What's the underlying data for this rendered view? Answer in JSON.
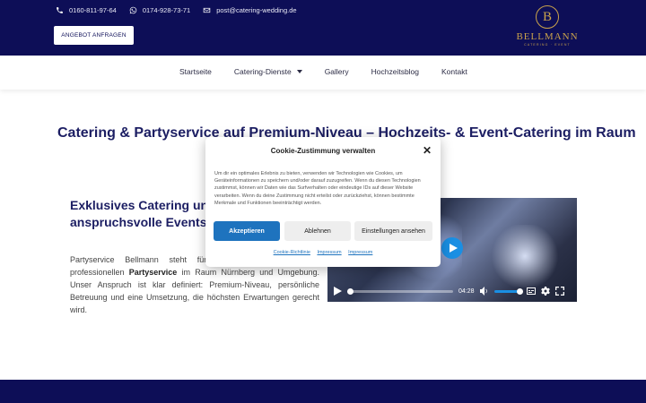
{
  "topbar": {
    "phone1": "0160-811-97-64",
    "phone2": "0174-928-73-71",
    "email": "post@catering-wedding.de",
    "cta_label": "ANGEBOT ANFRAGEN",
    "bg_color": "#0d0e57"
  },
  "logo": {
    "monogram": "B",
    "brand": "BELLMANN",
    "tagline": "CATERING · EVENT",
    "gold_color": "#c9a24b"
  },
  "nav": {
    "items": [
      {
        "label": "Startseite"
      },
      {
        "label": "Catering-Dienste"
      },
      {
        "label": "Gallery"
      },
      {
        "label": "Hochzeitsblog"
      },
      {
        "label": "Kontakt"
      }
    ]
  },
  "main": {
    "headline": "Catering & Partyservice auf Premium-Niveau – Hochzeits- & Event-Catering im Raum",
    "subhead": "Exklusives Catering und Partyservice für anspruchsvolle Events",
    "para_pre": "Partyservice Bellmann steht für exklusives Catering und professionellen ",
    "para_bold": "Partyservice",
    "para_post": " im Raum Nürnberg und Umgebung. Unser Anspruch ist klar definiert: Premium-Niveau, persönliche Betreuung und eine Umsetzung, die höchsten Erwartungen gerecht wird."
  },
  "video": {
    "time": "04:28",
    "accent_color": "#1a8fe3"
  },
  "cookie": {
    "title": "Cookie-Zustimmung verwalten",
    "body": "Um dir ein optimales Erlebnis zu bieten, verwenden wir Technologien wie Cookies, um Geräteinformationen zu speichern und/oder darauf zuzugreifen. Wenn du diesen Technologien zustimmst, können wir Daten wie das Surfverhalten oder eindeutige IDs auf dieser Website verarbeiten. Wenn du deine Zustimmung nicht erteilst oder zurückziehst, können bestimmte Merkmale und Funktionen beeinträchtigt werden.",
    "accept": "Akzeptieren",
    "deny": "Ablehnen",
    "settings": "Einstellungen ansehen",
    "links": [
      "Cookie-Richtlinie",
      "Impressum",
      "Impressum"
    ],
    "accent_color": "#1e73be"
  }
}
